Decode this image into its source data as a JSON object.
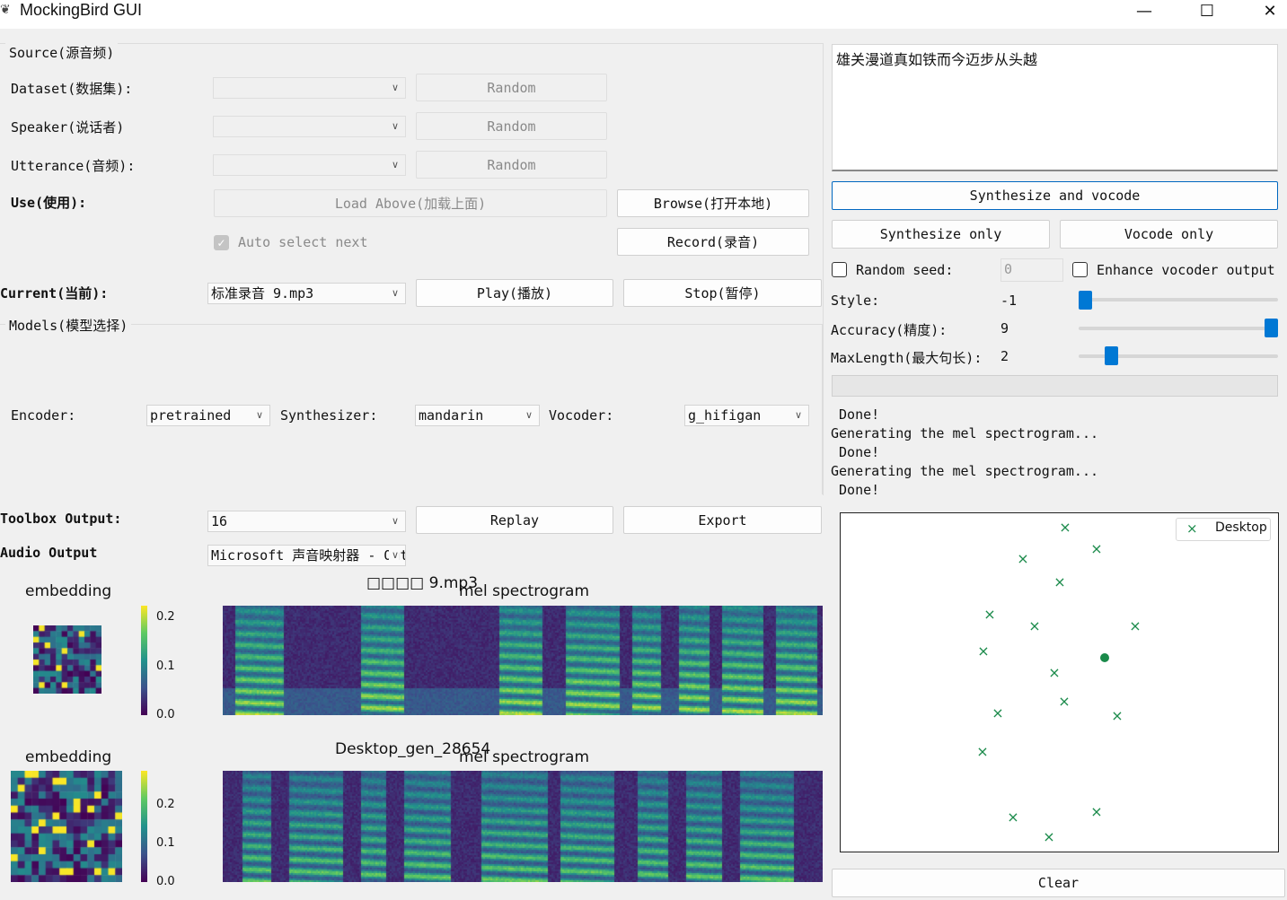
{
  "window": {
    "title": "MockingBird GUI",
    "minimize": "—",
    "maximize": "☐",
    "close": "✕"
  },
  "source": {
    "group_title": "Source(源音频)",
    "dataset_label": "Dataset(数据集):",
    "speaker_label": "Speaker(说话者)",
    "utterance_label": "Utterance(音频):",
    "random_label": "Random",
    "use_label": "Use(使用):",
    "load_above": "Load Above(加载上面)",
    "browse": "Browse(打开本地)",
    "auto_select": "Auto select next",
    "record": "Record(录音)"
  },
  "current": {
    "label": "Current(当前):",
    "value": "标准录音 9.mp3",
    "play": "Play(播放)",
    "stop": "Stop(暂停)"
  },
  "models": {
    "group_title": "Models(模型选择)",
    "encoder_label": "Encoder:",
    "encoder_value": "pretrained",
    "synth_label": "Synthesizer:",
    "synth_value": "mandarin",
    "vocoder_label": "Vocoder:",
    "vocoder_value": "g_hifigan"
  },
  "output": {
    "toolbox_label": "Toolbox Output:",
    "toolbox_value": "16",
    "replay": "Replay",
    "export": "Export",
    "audio_label": "Audio Output",
    "audio_value": "Microsoft 声音映射器 - Output"
  },
  "text_input": "雄关漫道真如铁而今迈步从头越",
  "synthesis": {
    "synth_and_vocode": "Synthesize and vocode",
    "synth_only": "Synthesize only",
    "vocode_only": "Vocode only",
    "random_seed_label": "Random seed:",
    "random_seed_value": "0",
    "enhance_label": "Enhance vocoder output",
    "style_label": "Style:",
    "style_value": "-1",
    "style_level": 0.0,
    "accuracy_label": "Accuracy(精度):",
    "accuracy_value": "9",
    "accuracy_level": 1.0,
    "maxlength_label": "MaxLength(最大句长):",
    "maxlength_value": "2",
    "maxlength_level": 0.14
  },
  "log_lines": [
    " Done!",
    "Generating the mel spectrogram...",
    " Done!",
    "Generating the mel spectrogram...",
    " Done!"
  ],
  "plots": {
    "embed1_title": "embedding",
    "spec1_title_prefix": "□□□□ 9.mp3",
    "spec1_title": "mel spectrogram",
    "colorbar1_ticks": [
      "0.2",
      "0.1",
      "0.0"
    ],
    "embed2_title": "embedding",
    "spec2_title_prefix": "Desktop_gen_28654",
    "spec2_title": "mel spectrogram",
    "colorbar2_ticks": [
      "0.2",
      "0.1",
      "0.0"
    ]
  },
  "umap": {
    "legend": "Desktop",
    "marker_color": "#1a8a4a"
  },
  "clear": "Clear"
}
